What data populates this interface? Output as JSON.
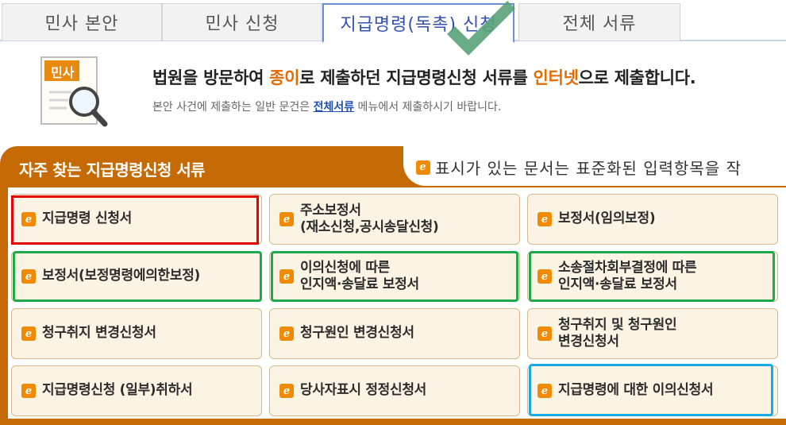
{
  "tabs": [
    {
      "label": "민사 본안",
      "active": false
    },
    {
      "label": "민사 신청",
      "active": false
    },
    {
      "label": "지급명령(독촉) 신청",
      "active": true
    },
    {
      "label": "전체 서류",
      "active": false
    }
  ],
  "intro": {
    "icon_label": "민사",
    "title_part1": "법원을 방문하여 ",
    "title_hl1": "종이",
    "title_part2": "로 제출하던 지급명령신청 서류를 ",
    "title_hl2": "인터넷",
    "title_part3": "으로 제출합니다.",
    "sub_part1": "본안 사건에 제출하는 일반 문건은 ",
    "sub_link": "전체서류",
    "sub_part2": " 메뉴에서 제출하시기 바랍니다."
  },
  "panel": {
    "title": "자주 찾는 지급명령신청 서류",
    "legend_text": "표시가 있는 문서는 표준화된 입력항목을 작"
  },
  "docs": [
    {
      "label": "지급명령 신청서"
    },
    {
      "label": "주소보정서\n(재소신청,공시송달신청)"
    },
    {
      "label": "보정서(임의보정)"
    },
    {
      "label": "보정서(보정명령에의한보정)"
    },
    {
      "label": "이의신청에 따른\n인지액·송달료 보정서"
    },
    {
      "label": "소송절차회부결정에 따른\n인지액·송달료 보정서"
    },
    {
      "label": "청구취지 변경신청서"
    },
    {
      "label": "청구원인 변경신청서"
    },
    {
      "label": "청구취지 및 청구원인\n변경신청서"
    },
    {
      "label": "지급명령신청 (일부)취하서"
    },
    {
      "label": "당사자표시 정정신청서"
    },
    {
      "label": "지급명령에 대한 이의신청서"
    }
  ],
  "icon_glyph": "e",
  "colors": {
    "accent_orange": "#c56a05",
    "highlight_orange": "#e66a00",
    "tab_active_border": "#6a8fd6",
    "link_blue": "#1f4fb3",
    "annotation_red": "#e60000",
    "annotation_green": "#1daa4a",
    "annotation_blue": "#19a9e3",
    "checkmark": "#5aa27a"
  }
}
